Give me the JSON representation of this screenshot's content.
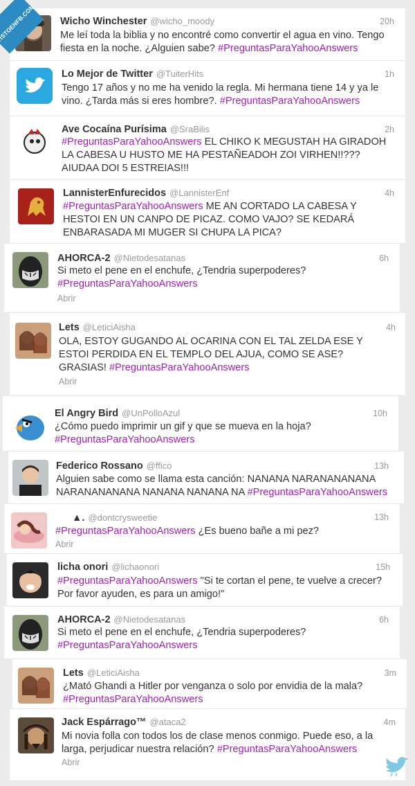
{
  "watermark": "VISTOENFB.COM",
  "tweets": [
    {
      "name": "Wicho Winchester",
      "handle": "@wicho_moody",
      "time": "20h",
      "text": "Me leí toda la biblia y no encontré como convertir el agua en vino. Tengo fiesta en la noche. ¿Alguien sabe?",
      "hashtag": "#PreguntasParaYahooAnswers",
      "avatar": "man-beard-avatar"
    },
    {
      "name": "Lo Mejor de Twitter",
      "handle": "@TuiterHits",
      "time": "1h",
      "text": "Tengo 17 años y no me ha venido la regla. Mi hermana tiene 14 y ya le vino. ¿Tarda más si eres hombre?.",
      "hashtag": "#PreguntasParaYahooAnswers",
      "avatar": "twitter-bird-avatar"
    },
    {
      "name": "Ave Cocaína Purísima",
      "handle": "@SraBilis",
      "time": "2h",
      "text_pre": "",
      "hashtag": "#PreguntasParaYahooAnswers",
      "text": "EL CHIKO K MEGUSTAH HA GIRADOH LA CABESA U HUSTO ME HA PESTAÑEADOH ZOI VIRHEN!!??? AIUDAA DOI 5 ESTREIAS!!!",
      "avatar": "cartoon-bird-avatar"
    },
    {
      "name": "LannisterEnfurecidos",
      "handle": "@LannisterEnf",
      "time": "4h",
      "hashtag": "#PreguntasParaYahooAnswers",
      "text": "ME AN CORTADO LA CABESA Y HESTOI EN UN CANPO DE PICAZ. COMO VAJO? SE KEDARÁ ENBARASADA MI MUGER SI CHUPA LA PICA?",
      "avatar": "lion-sigil-avatar"
    },
    {
      "name": "AHORCA-2",
      "handle": "@Nietodesatanas",
      "time": "6h",
      "text": "Si meto el pene en el enchufe, ¿Tendria superpoderes?",
      "hashtag": "#PreguntasParaYahooAnswers",
      "abrir": "Abrir",
      "avatar": "masked-face-avatar"
    },
    {
      "name": "Lets",
      "handle": "@LeticiAisha",
      "time": "4h",
      "text": "OLA, ESTOY GUGANDO AL OCARINA CON EL TAL ZELDA ESE Y ESTOI PERDIDA EN EL TEMPLO DEL AJUA, COMO SE ASE? GRASIAS!",
      "hashtag": "#PreguntasParaYahooAnswers",
      "abrir": "Abrir",
      "avatar": "girls-photo-avatar"
    },
    {
      "name": "El Angry Bird",
      "handle": "@UnPolloAzul",
      "time": "10h",
      "text": "¿Cómo puedo imprimir un gif y que se mueva en la hoja?",
      "hashtag": "#PreguntasParaYahooAnswers",
      "avatar": "blue-bird-avatar"
    },
    {
      "name": "Federico Rossano",
      "handle": "@ffico",
      "time": "13h",
      "text": "Alguien sabe como se llama esta canción: NANANA NARANANANANA NARANANANANA NANANA NANANA NA",
      "hashtag": "#PreguntasParaYahooAnswers",
      "avatar": "man-photo-avatar"
    },
    {
      "name": "▲.",
      "handle": "@dontcrysweetie",
      "time": "13h",
      "hashtag": "#PreguntasParaYahooAnswers",
      "text": "¿Es bueno bañe a mi pez?",
      "abrir": "Abrir",
      "avatar": "girl-lying-avatar"
    },
    {
      "name": "licha onori",
      "handle": "@lichaonori",
      "time": "15h",
      "hashtag": "#PreguntasParaYahooAnswers",
      "text": "\"Si te cortan el pene, te vuelve a crecer? Por favor ayuden, es para un amigo!\"",
      "avatar": "boy-face-avatar"
    },
    {
      "name": "AHORCA-2",
      "handle": "@Nietodesatanas",
      "time": "6h",
      "text": "Si meto el pene en el enchufe, ¿Tendria superpoderes?",
      "hashtag": "#PreguntasParaYahooAnswers",
      "avatar": "masked-face-avatar"
    },
    {
      "name": "Lets",
      "handle": "@LeticiAisha",
      "time": "3m",
      "text": "¿Mató Ghandi a Hitler por venganza o solo por envidia de la mala?",
      "hashtag": "#PreguntasParaYahooAnswers",
      "avatar": "girls-photo-avatar"
    },
    {
      "name": "Jack Espárrago™",
      "handle": "@ataca2",
      "time": "4m",
      "text": "Mi novia folla con todos los de clase menos conmigo. Puede eso, a la larga, perjudicar nuestra relación?",
      "hashtag": "#PreguntasParaYahooAnswers",
      "abrir": "Abrir",
      "avatar": "pirate-avatar"
    }
  ],
  "colors": {
    "hashtag": "#a01fb5",
    "name": "#333333",
    "meta": "#999999",
    "badge": "#2b8bc2"
  }
}
